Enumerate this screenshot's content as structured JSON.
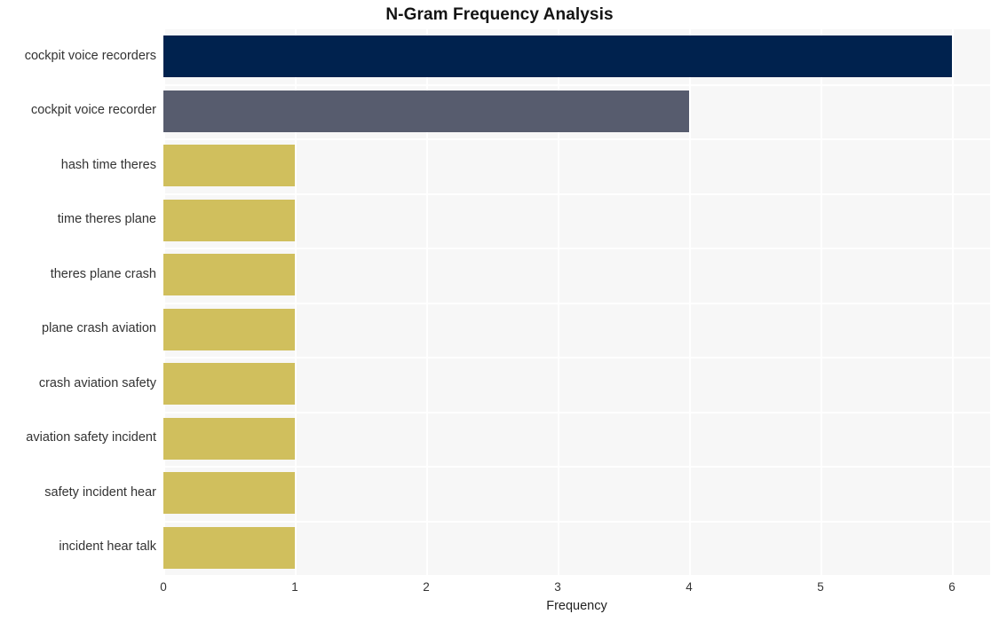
{
  "chart_data": {
    "type": "bar",
    "orientation": "horizontal",
    "title": "N-Gram Frequency Analysis",
    "xlabel": "Frequency",
    "ylabel": "",
    "categories": [
      "cockpit voice recorders",
      "cockpit voice recorder",
      "hash time theres",
      "time theres plane",
      "theres plane crash",
      "plane crash aviation",
      "crash aviation safety",
      "aviation safety incident",
      "safety incident hear",
      "incident hear talk"
    ],
    "values": [
      6,
      4,
      1,
      1,
      1,
      1,
      1,
      1,
      1,
      1
    ],
    "bar_colors": [
      "#00224e",
      "#575c6e",
      "#d0bf5d",
      "#d0bf5d",
      "#d0bf5d",
      "#d0bf5d",
      "#d0bf5d",
      "#d0bf5d",
      "#d0bf5d",
      "#d0bf5d"
    ],
    "xticks": [
      "0",
      "1",
      "2",
      "3",
      "4",
      "5",
      "6"
    ],
    "xlim": [
      0,
      6.29
    ],
    "grid": true,
    "grid_color": "#ffffff",
    "plot_background": "#f7f7f7",
    "figure_background": "#ffffff",
    "legend": null
  }
}
